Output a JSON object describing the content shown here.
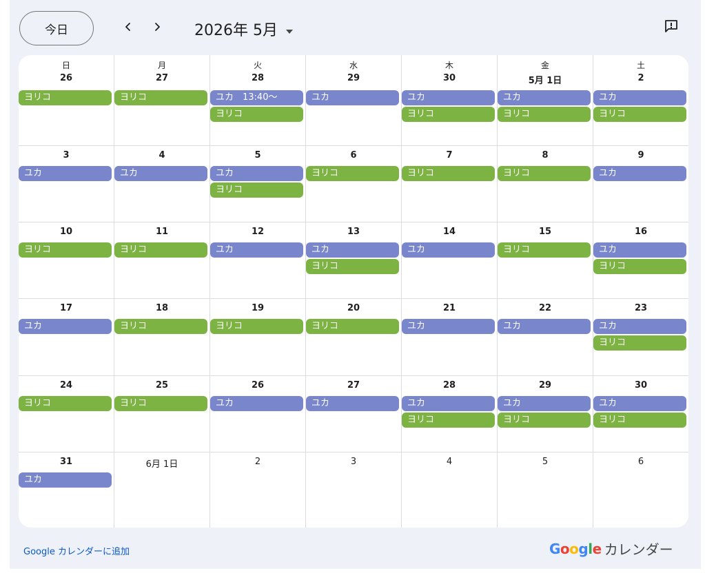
{
  "toolbar": {
    "today_label": "今日",
    "prev_icon": "chevron-left-icon",
    "next_icon": "chevron-right-icon",
    "month_title": "2026年 5月",
    "dropdown_icon": "caret-down-icon",
    "feedback_icon": "feedback-icon"
  },
  "colors": {
    "yuka": "#7986cb",
    "yoriko": "#7cb342",
    "background": "#eef2f8",
    "link": "#0b57d0"
  },
  "calendar": {
    "weekdays": [
      "日",
      "月",
      "火",
      "水",
      "木",
      "金",
      "土"
    ],
    "weeks": [
      [
        {
          "date": "26",
          "events": [
            {
              "title": "ヨリコ",
              "cal": "yoriko"
            }
          ]
        },
        {
          "date": "27",
          "events": [
            {
              "title": "ヨリコ",
              "cal": "yoriko"
            }
          ]
        },
        {
          "date": "28",
          "events": [
            {
              "title": "ユカ　13:40～",
              "cal": "yuka"
            },
            {
              "title": "ヨリコ",
              "cal": "yoriko"
            }
          ]
        },
        {
          "date": "29",
          "events": [
            {
              "title": "ユカ",
              "cal": "yuka"
            }
          ]
        },
        {
          "date": "30",
          "events": [
            {
              "title": "ユカ",
              "cal": "yuka"
            },
            {
              "title": "ヨリコ",
              "cal": "yoriko"
            }
          ]
        },
        {
          "date": "5月 1日",
          "events": [
            {
              "title": "ユカ",
              "cal": "yuka"
            },
            {
              "title": "ヨリコ",
              "cal": "yoriko"
            }
          ]
        },
        {
          "date": "2",
          "events": [
            {
              "title": "ユカ",
              "cal": "yuka"
            },
            {
              "title": "ヨリコ",
              "cal": "yoriko"
            }
          ]
        }
      ],
      [
        {
          "date": "3",
          "events": [
            {
              "title": "ユカ",
              "cal": "yuka"
            }
          ]
        },
        {
          "date": "4",
          "events": [
            {
              "title": "ユカ",
              "cal": "yuka"
            }
          ]
        },
        {
          "date": "5",
          "events": [
            {
              "title": "ユカ",
              "cal": "yuka"
            },
            {
              "title": "ヨリコ",
              "cal": "yoriko"
            }
          ]
        },
        {
          "date": "6",
          "events": [
            {
              "title": "ヨリコ",
              "cal": "yoriko"
            }
          ]
        },
        {
          "date": "7",
          "events": [
            {
              "title": "ヨリコ",
              "cal": "yoriko"
            }
          ]
        },
        {
          "date": "8",
          "events": [
            {
              "title": "ヨリコ",
              "cal": "yoriko"
            }
          ]
        },
        {
          "date": "9",
          "events": [
            {
              "title": "ユカ",
              "cal": "yuka"
            }
          ]
        }
      ],
      [
        {
          "date": "10",
          "events": [
            {
              "title": "ヨリコ",
              "cal": "yoriko"
            }
          ]
        },
        {
          "date": "11",
          "events": [
            {
              "title": "ヨリコ",
              "cal": "yoriko"
            }
          ]
        },
        {
          "date": "12",
          "events": [
            {
              "title": "ユカ",
              "cal": "yuka"
            }
          ]
        },
        {
          "date": "13",
          "events": [
            {
              "title": "ユカ",
              "cal": "yuka"
            },
            {
              "title": "ヨリコ",
              "cal": "yoriko"
            }
          ]
        },
        {
          "date": "14",
          "events": [
            {
              "title": "ユカ",
              "cal": "yuka"
            }
          ]
        },
        {
          "date": "15",
          "events": [
            {
              "title": "ヨリコ",
              "cal": "yoriko"
            }
          ]
        },
        {
          "date": "16",
          "events": [
            {
              "title": "ユカ",
              "cal": "yuka"
            },
            {
              "title": "ヨリコ",
              "cal": "yoriko"
            }
          ]
        }
      ],
      [
        {
          "date": "17",
          "events": [
            {
              "title": "ユカ",
              "cal": "yuka"
            }
          ]
        },
        {
          "date": "18",
          "events": [
            {
              "title": "ヨリコ",
              "cal": "yoriko"
            }
          ]
        },
        {
          "date": "19",
          "events": [
            {
              "title": "ヨリコ",
              "cal": "yoriko"
            }
          ]
        },
        {
          "date": "20",
          "events": [
            {
              "title": "ヨリコ",
              "cal": "yoriko"
            }
          ]
        },
        {
          "date": "21",
          "events": [
            {
              "title": "ユカ",
              "cal": "yuka"
            }
          ]
        },
        {
          "date": "22",
          "events": [
            {
              "title": "ユカ",
              "cal": "yuka"
            }
          ]
        },
        {
          "date": "23",
          "events": [
            {
              "title": "ユカ",
              "cal": "yuka"
            },
            {
              "title": "ヨリコ",
              "cal": "yoriko"
            }
          ]
        }
      ],
      [
        {
          "date": "24",
          "events": [
            {
              "title": "ヨリコ",
              "cal": "yoriko"
            }
          ]
        },
        {
          "date": "25",
          "events": [
            {
              "title": "ヨリコ",
              "cal": "yoriko"
            }
          ]
        },
        {
          "date": "26",
          "events": [
            {
              "title": "ユカ",
              "cal": "yuka"
            }
          ]
        },
        {
          "date": "27",
          "events": [
            {
              "title": "ユカ",
              "cal": "yuka"
            }
          ]
        },
        {
          "date": "28",
          "events": [
            {
              "title": "ユカ",
              "cal": "yuka"
            },
            {
              "title": "ヨリコ",
              "cal": "yoriko"
            }
          ]
        },
        {
          "date": "29",
          "events": [
            {
              "title": "ユカ",
              "cal": "yuka"
            },
            {
              "title": "ヨリコ",
              "cal": "yoriko"
            }
          ]
        },
        {
          "date": "30",
          "events": [
            {
              "title": "ユカ",
              "cal": "yuka"
            },
            {
              "title": "ヨリコ",
              "cal": "yoriko"
            }
          ]
        }
      ],
      [
        {
          "date": "31",
          "events": [
            {
              "title": "ユカ",
              "cal": "yuka"
            }
          ]
        },
        {
          "date": "6月 1日",
          "other": true,
          "events": []
        },
        {
          "date": "2",
          "other": true,
          "events": []
        },
        {
          "date": "3",
          "other": true,
          "events": []
        },
        {
          "date": "4",
          "other": true,
          "events": []
        },
        {
          "date": "5",
          "other": true,
          "events": []
        },
        {
          "date": "6",
          "other": true,
          "events": []
        }
      ]
    ]
  },
  "footer": {
    "add_link": "Google カレンダーに追加",
    "brand_logo_letters": [
      "G",
      "o",
      "o",
      "g",
      "l",
      "e"
    ],
    "brand_logo_colors": [
      "#4285f4",
      "#ea4335",
      "#fbbc05",
      "#4285f4",
      "#34a853",
      "#ea4335"
    ],
    "brand_name": "カレンダー"
  }
}
